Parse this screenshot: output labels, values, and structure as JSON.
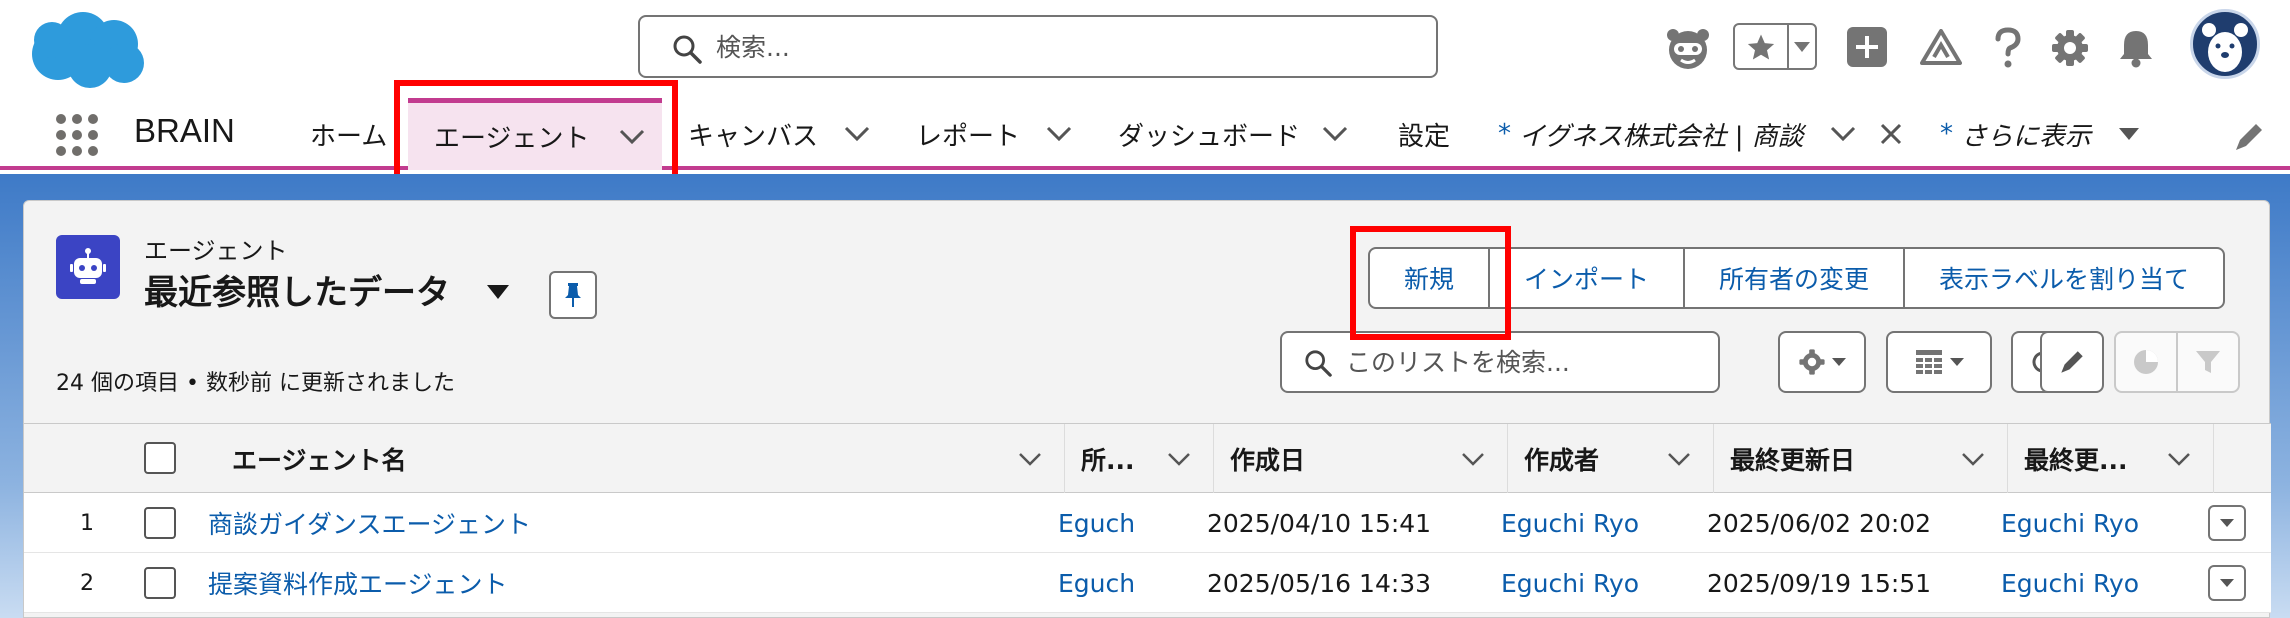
{
  "header": {
    "search_placeholder": "検索..."
  },
  "nav": {
    "app_name": "BRAIN",
    "items": [
      {
        "label": "ホーム"
      },
      {
        "label": "エージェント"
      },
      {
        "label": "キャンバス"
      },
      {
        "label": "レポート"
      },
      {
        "label": "ダッシュボード"
      },
      {
        "label": "設定"
      },
      {
        "label": "イグネス株式会社 | 商談",
        "prefix": "*"
      },
      {
        "label": "さらに表示",
        "prefix": "*"
      }
    ]
  },
  "list": {
    "object_label": "エージェント",
    "title": "最近参照したデータ",
    "status": "24 個の項目 • 数秒前 に更新されました",
    "actions": [
      "新規",
      "インポート",
      "所有者の変更",
      "表示ラベルを割り当て"
    ],
    "search_placeholder": "このリストを検索..."
  },
  "table": {
    "columns": [
      "エージェント名",
      "所...",
      "作成日",
      "作成者",
      "最終更新日",
      "最終更..."
    ],
    "rows": [
      {
        "num": "1",
        "name": "商談ガイダンスエージェント",
        "owner": "Eguch",
        "created": "2025/04/10 15:41",
        "creator": "Eguchi Ryo",
        "modified": "2025/06/02 20:02",
        "modifier": "Eguchi Ryo"
      },
      {
        "num": "2",
        "name": "提案資料作成エージェント",
        "owner": "Eguch",
        "created": "2025/05/16 14:33",
        "creator": "Eguchi Ryo",
        "modified": "2025/09/19 15:51",
        "modifier": "Eguchi Ryo"
      }
    ]
  },
  "colors": {
    "brand_blue": "#0b5cab",
    "accent_pink": "#c23b8f",
    "object_icon": "#3b44c4",
    "highlight_red": "#ff0000"
  },
  "icons": [
    "salesforce-cloud-logo",
    "search-icon",
    "einstein-icon",
    "star-icon",
    "plus-icon",
    "trailhead-icon",
    "help-icon",
    "gear-icon",
    "bell-icon",
    "avatar",
    "waffle-icon",
    "chevron-down-icon",
    "close-icon",
    "pencil-icon",
    "robot-icon",
    "pin-icon",
    "refresh-icon",
    "table-icon",
    "chart-icon",
    "filter-icon"
  ]
}
